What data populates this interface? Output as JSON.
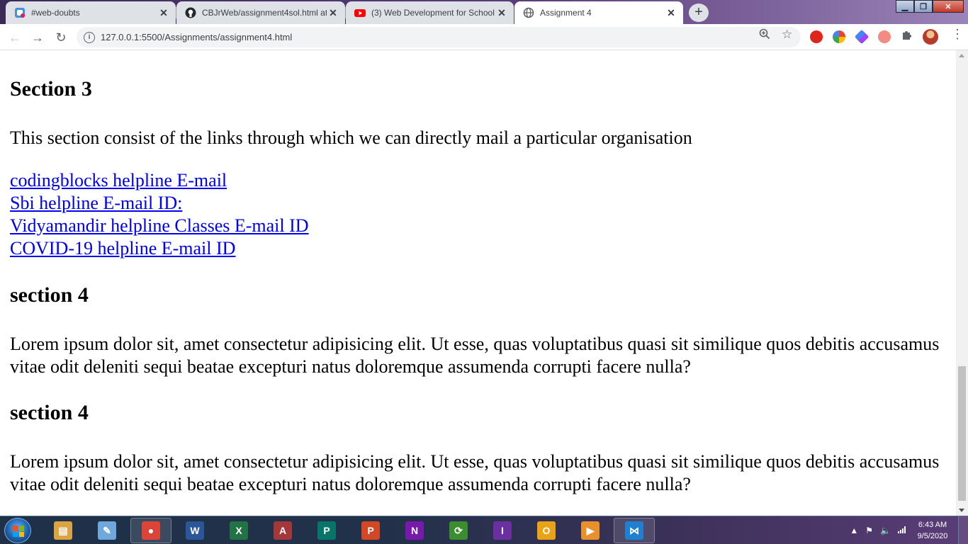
{
  "browser": {
    "tabs": [
      {
        "title": "#web-doubts",
        "icon": "slack-like-icon",
        "active": false
      },
      {
        "title": "CBJrWeb/assignment4sol.html at",
        "icon": "github-icon",
        "active": false
      },
      {
        "title": "(3) Web Development for School",
        "icon": "youtube-icon",
        "active": false
      },
      {
        "title": "Assignment 4",
        "icon": "globe-icon",
        "active": true
      }
    ],
    "close_glyph": "✕",
    "new_tab_glyph": "+",
    "address": "127.0.0.1:5500/Assignments/assignment4.html",
    "info_glyph": "i"
  },
  "page": {
    "section3_heading": "Section 3",
    "section3_text": "This section consist of the links through which we can directly mail a particular organisation",
    "links": [
      "codingblocks helpline E-mail",
      "Sbi helpline E-mail ID:",
      "Vidyamandir helpline Classes E-mail ID",
      "COVID-19 helpline E-mail ID"
    ],
    "section4a_heading": "section 4",
    "section4a_text": "Lorem ipsum dolor sit, amet consectetur adipisicing elit. Ut esse, quas voluptatibus quasi sit similique quos debitis accusamus vitae odit deleniti sequi beatae excepturi natus doloremque assumenda corrupti facere nulla?",
    "section4b_heading": "section 4",
    "section4b_text": "Lorem ipsum dolor sit, amet consectetur adipisicing elit. Ut esse, quas voluptatibus quasi sit similique quos debitis accusamus vitae odit deleniti sequi beatae excepturi natus doloremque assumenda corrupti facere nulla?"
  },
  "taskbar": {
    "apps": [
      {
        "name": "file-explorer",
        "glyph": "▤",
        "color": "#d9a441"
      },
      {
        "name": "notepad",
        "glyph": "✎",
        "color": "#6fa8dc"
      },
      {
        "name": "chrome",
        "glyph": "●",
        "color": "#db4437"
      },
      {
        "name": "word",
        "glyph": "W",
        "color": "#2b579a"
      },
      {
        "name": "excel",
        "glyph": "X",
        "color": "#217346"
      },
      {
        "name": "access",
        "glyph": "A",
        "color": "#a4373a"
      },
      {
        "name": "publisher",
        "glyph": "P",
        "color": "#077568"
      },
      {
        "name": "powerpoint",
        "glyph": "P",
        "color": "#d24726"
      },
      {
        "name": "onenote",
        "glyph": "N",
        "color": "#7719aa"
      },
      {
        "name": "sync",
        "glyph": "⟳",
        "color": "#3c8d2f"
      },
      {
        "name": "infopath",
        "glyph": "I",
        "color": "#6b2fa0"
      },
      {
        "name": "outlook",
        "glyph": "O",
        "color": "#e8a317"
      },
      {
        "name": "media-player",
        "glyph": "▶",
        "color": "#e8912c"
      },
      {
        "name": "vscode",
        "glyph": "⋈",
        "color": "#1f7fd1"
      }
    ],
    "time": "6:43 AM",
    "date": "9/5/2020"
  },
  "colors": {
    "link": "#0000ee",
    "tab_inactive": "#dee1e6",
    "tab_active": "#ffffff"
  }
}
